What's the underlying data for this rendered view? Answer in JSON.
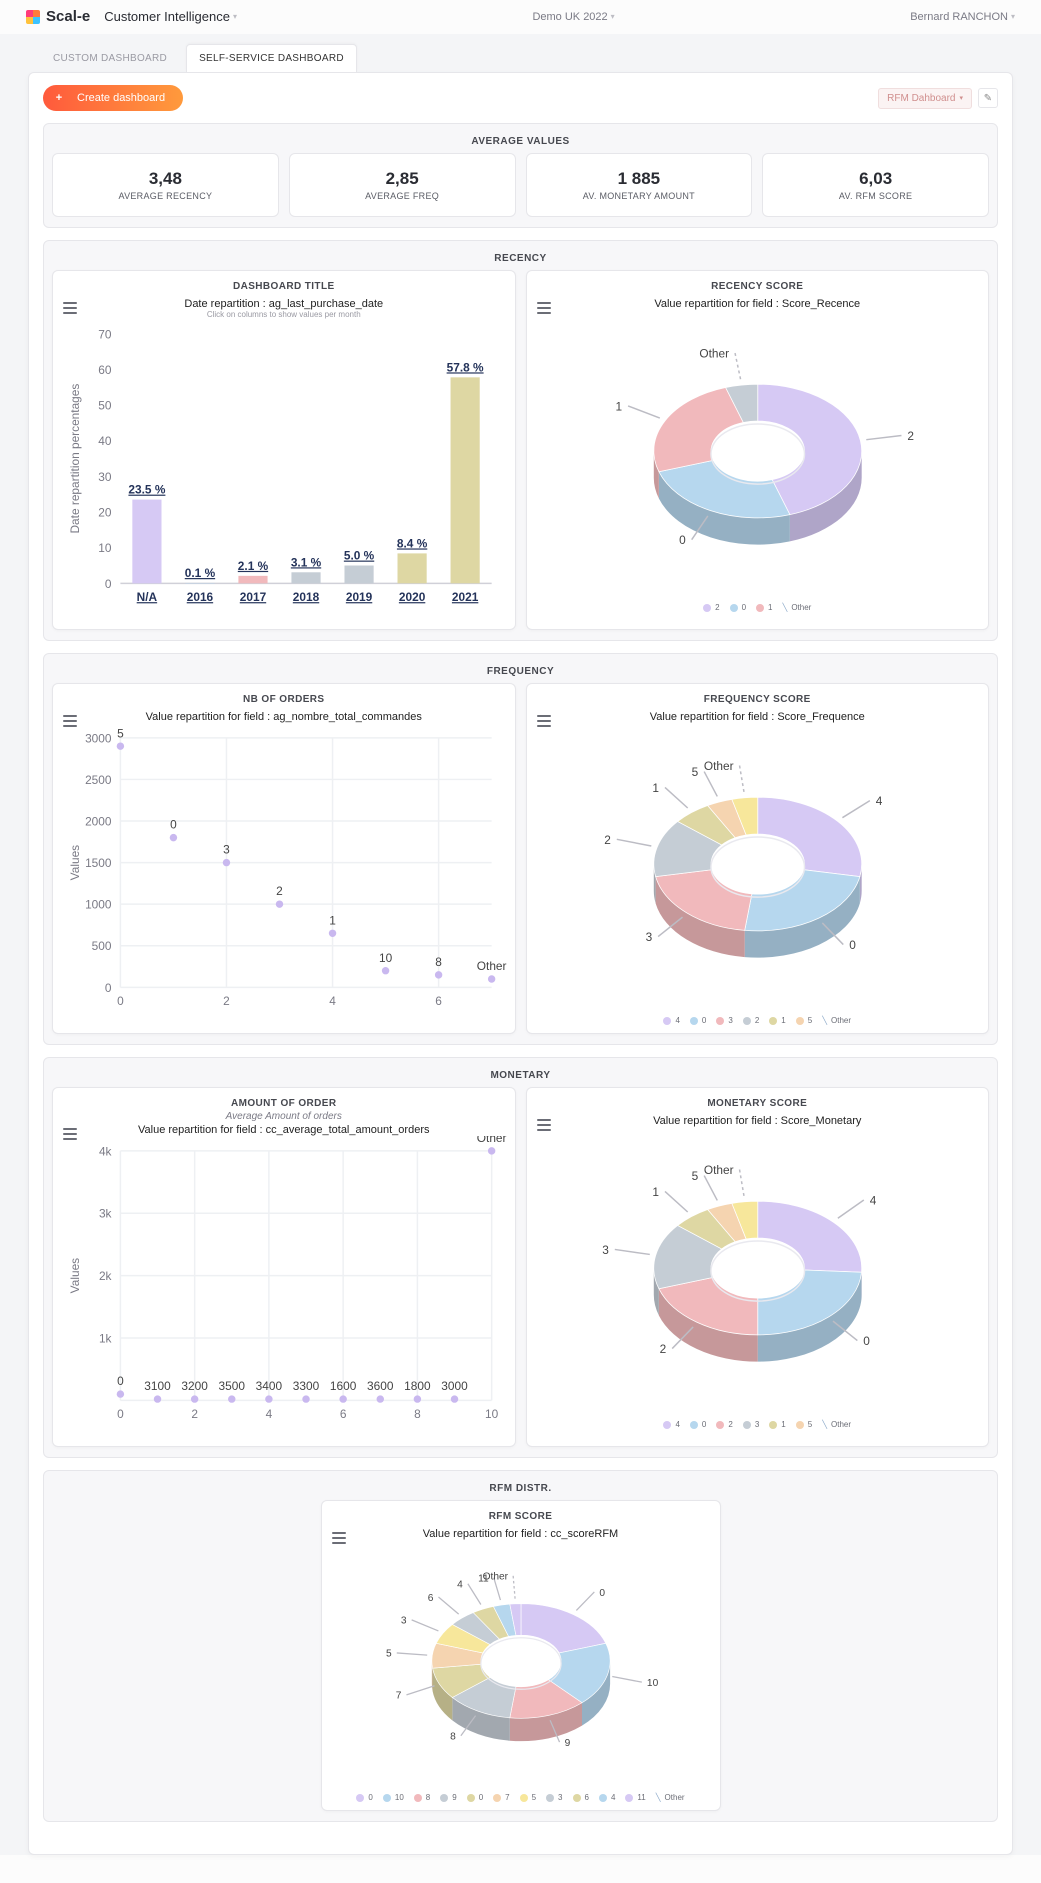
{
  "brand": "Scal-e",
  "app_section": "Customer Intelligence",
  "workspace": "Demo UK 2022",
  "user": "Bernard RANCHON",
  "tabs": {
    "custom": "CUSTOM DASHBOARD",
    "self": "SELF-SERVICE DASHBOARD"
  },
  "buttons": {
    "create": "Create dashboard"
  },
  "dashboard_selector": "RFM Dahboard",
  "sections": {
    "avg": "AVERAGE VALUES",
    "recency": "RECENCY",
    "frequency": "FREQUENCY",
    "monetary": "MONETARY",
    "rfm": "RFM DISTR."
  },
  "kpis": [
    {
      "value": "3,48",
      "label": "AVERAGE RECENCY"
    },
    {
      "value": "2,85",
      "label": "AVERAGE FREQ"
    },
    {
      "value": "1 885",
      "label": "AV. MONETARY AMOUNT"
    },
    {
      "value": "6,03",
      "label": "AV. RFM SCORE"
    }
  ],
  "cards": {
    "dash_title": {
      "header": "DASHBOARD TITLE",
      "title": "Date repartition : ag_last_purchase_date",
      "subtitle": "Click on columns to show values per month",
      "ylabel": "Date repartition percentages"
    },
    "recency_score": {
      "header": "RECENCY SCORE",
      "title": "Value repartition for field : Score_Recence"
    },
    "nb_orders": {
      "header": "NB OF ORDERS",
      "title": "Value repartition for field : ag_nombre_total_commandes",
      "ylabel": "Values"
    },
    "freq_score": {
      "header": "FREQUENCY SCORE",
      "title": "Value repartition for field : Score_Frequence"
    },
    "amount": {
      "header": "AMOUNT OF ORDER",
      "sub": "Average Amount of orders",
      "title": "Value repartition for field : cc_average_total_amount_orders",
      "ylabel": "Values"
    },
    "monetary_score": {
      "header": "MONETARY SCORE",
      "title": "Value repartition for field : Score_Monetary"
    },
    "rfm_score": {
      "header": "RFM SCORE",
      "title": "Value repartition for field : cc_scoreRFM"
    }
  },
  "colors": {
    "lavender": "#d6c9f4",
    "blue": "#b6d7ee",
    "pink": "#f1b9bc",
    "grey": "#c5cdd5",
    "sand": "#ded7a3",
    "peach": "#f5d4b0",
    "yellow": "#f7e79b"
  },
  "chart_data": [
    {
      "id": "recency_bar",
      "type": "bar",
      "categories": [
        "N/A",
        "2016",
        "2017",
        "2018",
        "2019",
        "2020",
        "2021"
      ],
      "values": [
        23.5,
        0.1,
        2.1,
        3.1,
        5.0,
        8.4,
        57.8
      ],
      "value_labels": [
        "23.5 %",
        "0.1 %",
        "2.1 %",
        "3.1 %",
        "5.0 %",
        "8.4 %",
        "57.8 %"
      ],
      "bar_colors": [
        "lavender",
        "blue",
        "pink",
        "grey",
        "grey",
        "sand",
        "sand"
      ],
      "yticks": [
        0,
        10,
        20,
        30,
        40,
        50,
        60,
        70
      ],
      "ylim": [
        0,
        70
      ],
      "title": "Date repartition : ag_last_purchase_date",
      "ylabel": "Date repartition percentages"
    },
    {
      "id": "recency_donut",
      "type": "pie",
      "slices": [
        {
          "label": "2",
          "value": 45,
          "color": "lavender"
        },
        {
          "label": "0",
          "value": 25,
          "color": "blue"
        },
        {
          "label": "1",
          "value": 25,
          "color": "pink"
        },
        {
          "label": "Other",
          "value": 5,
          "color": "grey"
        }
      ],
      "legend": [
        "2",
        "0",
        "1",
        "Other"
      ]
    },
    {
      "id": "nb_orders_scatter",
      "type": "scatter",
      "points": [
        {
          "x": 0,
          "y": 2900,
          "label": "5"
        },
        {
          "x": 1,
          "y": 1800,
          "label": "0"
        },
        {
          "x": 2,
          "y": 1500,
          "label": "3"
        },
        {
          "x": 3,
          "y": 1000,
          "label": "2"
        },
        {
          "x": 4,
          "y": 650,
          "label": "1"
        },
        {
          "x": 5,
          "y": 200,
          "label": "10"
        },
        {
          "x": 6,
          "y": 150,
          "label": "8"
        },
        {
          "x": 7,
          "y": 100,
          "label": "Other"
        }
      ],
      "xticks": [
        0,
        2,
        4,
        6
      ],
      "yticks": [
        0,
        500,
        1000,
        1500,
        2000,
        2500,
        3000
      ],
      "ylim": [
        0,
        3000
      ],
      "xlim": [
        0,
        7
      ],
      "ylabel": "Values"
    },
    {
      "id": "freq_donut",
      "type": "pie",
      "slices": [
        {
          "label": "4",
          "value": 28,
          "color": "lavender"
        },
        {
          "label": "0",
          "value": 24,
          "color": "blue"
        },
        {
          "label": "3",
          "value": 20,
          "color": "pink"
        },
        {
          "label": "2",
          "value": 14,
          "color": "grey"
        },
        {
          "label": "1",
          "value": 6,
          "color": "sand"
        },
        {
          "label": "5",
          "value": 4,
          "color": "peach"
        },
        {
          "label": "Other",
          "value": 4,
          "color": "yellow"
        }
      ],
      "legend": [
        "4",
        "0",
        "3",
        "2",
        "1",
        "5",
        "Other"
      ]
    },
    {
      "id": "amount_scatter",
      "type": "scatter",
      "points": [
        {
          "x": 0,
          "y": 100,
          "label": "0"
        },
        {
          "x": 1,
          "y": 20,
          "label": "3100"
        },
        {
          "x": 2,
          "y": 20,
          "label": "3200"
        },
        {
          "x": 3,
          "y": 20,
          "label": "3500"
        },
        {
          "x": 4,
          "y": 20,
          "label": "3400"
        },
        {
          "x": 5,
          "y": 20,
          "label": "3300"
        },
        {
          "x": 6,
          "y": 20,
          "label": "1600"
        },
        {
          "x": 7,
          "y": 20,
          "label": "3600"
        },
        {
          "x": 8,
          "y": 20,
          "label": "1800"
        },
        {
          "x": 9,
          "y": 20,
          "label": "3000"
        },
        {
          "x": 10,
          "y": 4000,
          "label": "Other"
        }
      ],
      "xticks": [
        0,
        2,
        4,
        6,
        8,
        10
      ],
      "yticks": [
        0,
        1000,
        2000,
        3000,
        4000
      ],
      "ytick_labels": [
        "",
        "1k",
        "2k",
        "3k",
        "4k"
      ],
      "ylim": [
        0,
        4000
      ],
      "xlim": [
        0,
        10
      ],
      "ylabel": "Values"
    },
    {
      "id": "monetary_donut",
      "type": "pie",
      "slices": [
        {
          "label": "4",
          "value": 26,
          "color": "lavender"
        },
        {
          "label": "0",
          "value": 24,
          "color": "blue"
        },
        {
          "label": "2",
          "value": 20,
          "color": "pink"
        },
        {
          "label": "3",
          "value": 16,
          "color": "grey"
        },
        {
          "label": "1",
          "value": 6,
          "color": "sand"
        },
        {
          "label": "5",
          "value": 4,
          "color": "peach"
        },
        {
          "label": "Other",
          "value": 4,
          "color": "yellow"
        }
      ],
      "legend": [
        "4",
        "0",
        "2",
        "3",
        "1",
        "5",
        "Other"
      ]
    },
    {
      "id": "rfm_donut",
      "type": "pie",
      "slices": [
        {
          "label": "0",
          "value": 20,
          "color": "lavender"
        },
        {
          "label": "10",
          "value": 18,
          "color": "blue"
        },
        {
          "label": "9",
          "value": 14,
          "color": "pink"
        },
        {
          "label": "8",
          "value": 12,
          "color": "grey"
        },
        {
          "label": "7",
          "value": 9,
          "color": "sand"
        },
        {
          "label": "5",
          "value": 7,
          "color": "peach"
        },
        {
          "label": "3",
          "value": 6,
          "color": "yellow"
        },
        {
          "label": "6",
          "value": 5,
          "color": "grey"
        },
        {
          "label": "4",
          "value": 4,
          "color": "sand"
        },
        {
          "label": "11",
          "value": 3,
          "color": "blue"
        },
        {
          "label": "Other",
          "value": 2,
          "color": "lavender"
        }
      ],
      "legend": [
        "0",
        "10",
        "8",
        "9",
        "0",
        "7",
        "5",
        "3",
        "6",
        "4",
        "11",
        "Other"
      ]
    }
  ]
}
